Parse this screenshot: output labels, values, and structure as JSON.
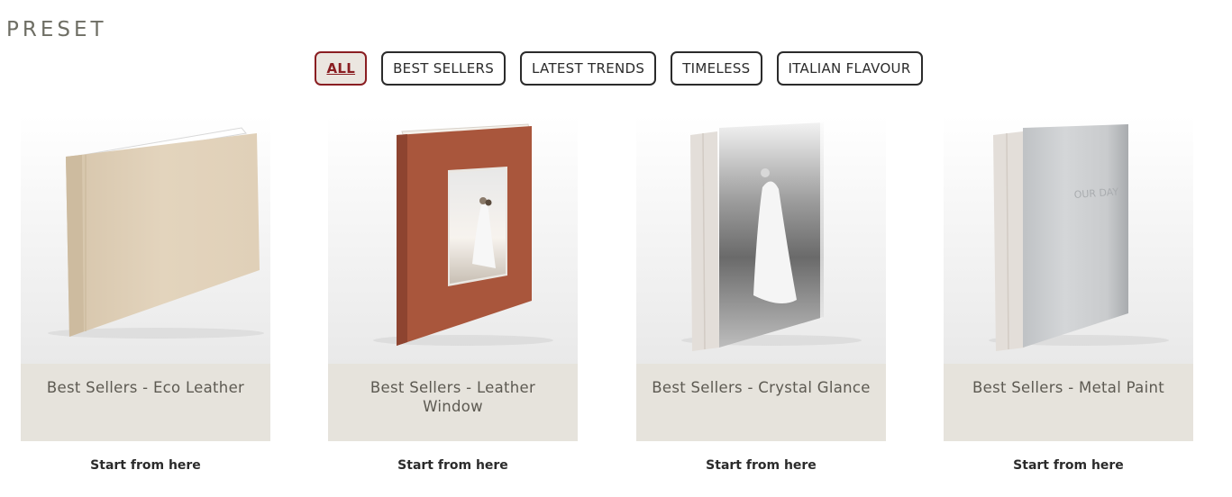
{
  "page": {
    "title": "PRESET"
  },
  "filters": [
    {
      "label": "ALL",
      "active": true
    },
    {
      "label": "BEST SELLERS",
      "active": false
    },
    {
      "label": "LATEST TRENDS",
      "active": false
    },
    {
      "label": "TIMELESS",
      "active": false
    },
    {
      "label": "ITALIAN FLAVOUR",
      "active": false
    }
  ],
  "products": [
    {
      "label": "Best Sellers - Eco Leather",
      "cta": "Start from here"
    },
    {
      "label": "Best Sellers - Leather Window",
      "cta": "Start from here"
    },
    {
      "label": "Best Sellers - Crystal Glance",
      "cta": "Start from here"
    },
    {
      "label": "Best Sellers - Metal Paint",
      "cta": "Start from here",
      "cover_text": "OUR DAY"
    }
  ],
  "colors": {
    "accent": "#8a1e22",
    "label_background": "#e6e3dc",
    "eco_leather": "#e1d2bb",
    "leather_window": "#b05a40",
    "metal_paint": "#c4c6c8"
  }
}
